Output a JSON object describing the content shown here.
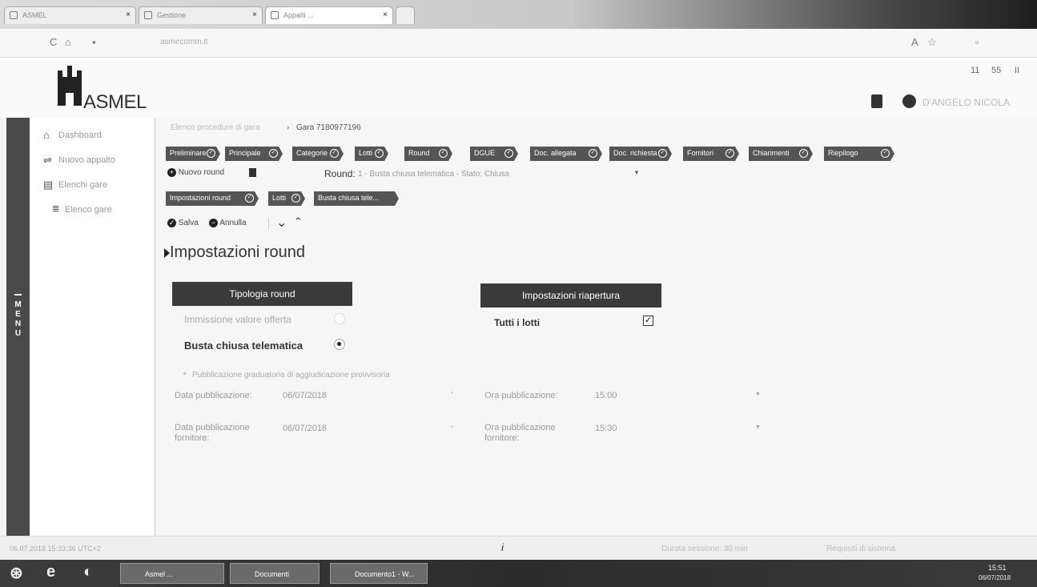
{
  "browser": {
    "tabs": [
      "ASMEL",
      "Gestione",
      "Appalti ... "
    ],
    "address": "asmecomm.it",
    "right_controls": [
      "11",
      "55",
      "II"
    ]
  },
  "header": {
    "logo": "ASMEL",
    "user_name": "D'ANGELO NICOLA"
  },
  "rail": {
    "label": "MENU"
  },
  "sidebar": {
    "items": [
      "Dashboard",
      "Nuovo appalto",
      "Elenchi gare",
      "Elenco gare"
    ]
  },
  "breadcrumb": {
    "part1": "Elenco procedure di gara",
    "sep": "›",
    "part2": "Gara 7180977196"
  },
  "steps": [
    "Preliminare",
    "Principale",
    "Categorie",
    "Lotti",
    "Round",
    "DGUE",
    "Doc. allegata",
    "Doc. richiesta",
    "Fornitori",
    "Chiarimenti",
    "Riepilogo"
  ],
  "round_bar": {
    "new_round": "Nuovo round",
    "round_label": "Round:",
    "round_value": "1 - Busta chiusa telematica - Stato: Chiusa"
  },
  "subtabs": [
    "Impostazioni round",
    "Lotti",
    "Busta chiusa tele..."
  ],
  "actions": {
    "save": "Salva",
    "cancel": "Annulla"
  },
  "section_title": "Impostazioni round",
  "left_panel": {
    "title": "Tipologia round",
    "option1": "Immissione valore offerta",
    "option2": "Busta chiusa telematica",
    "publication_link": "Pubblicazione graduatoria di aggiudicazione provvisoria"
  },
  "right_panel": {
    "title": "Impostazioni riapertura",
    "all_lots": "Tutti i lotti"
  },
  "fields": {
    "pub_date_label": "Data pubblicazione:",
    "pub_date_value": "06/07/2018",
    "pub_time_label": "Ora pubblicazione:",
    "pub_time_value": "15:00",
    "supplier_date_label": "Data pubblicazione fornitore:",
    "supplier_date_value": "06/07/2018",
    "supplier_time_label": "Ora pubblicazione fornitore:",
    "supplier_time_value": "15:30"
  },
  "status": {
    "left": "06.07.2018 15:33:36 UTC+2",
    "center": "Durata sessione: 30 min",
    "right": "Requisiti di sistema"
  },
  "taskbar": {
    "items": [
      "Asmel ...",
      "Documenti",
      "Documento1 - W..."
    ],
    "clock_time": "15:51",
    "clock_date": "06/07/2018"
  },
  "colors": {
    "dark_header": "#3a3a3a",
    "pill_bg": "#555555",
    "rail_bg": "#4a4a4a"
  }
}
